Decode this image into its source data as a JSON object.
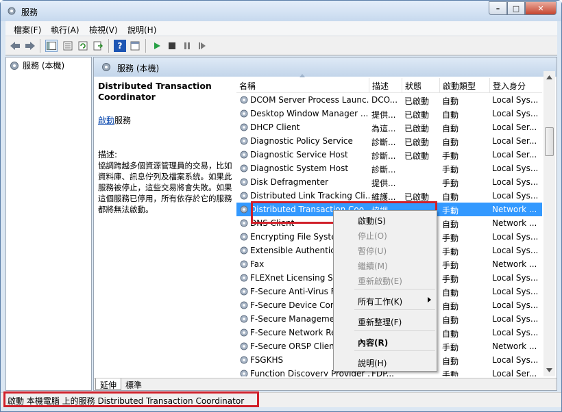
{
  "window": {
    "title": "服務",
    "btn_min": "–",
    "btn_max": "□",
    "btn_close": "✕"
  },
  "menu": [
    "檔案(F)",
    "執行(A)",
    "檢視(V)",
    "說明(H)"
  ],
  "left_tree": {
    "label": "服務 (本機)"
  },
  "right_header": {
    "label": "服務 (本機)"
  },
  "description": {
    "title": "Distributed Transaction Coordinator",
    "start_link": "啟動",
    "start_suffix": "服務",
    "label": "描述:",
    "text": "協調跨越多個資源管理員的交易，比如資料庫、訊息佇列及檔案系統。如果此服務被停止，這些交易將會失敗。如果這個服務已停用，所有依存於它的服務都將無法啟動。"
  },
  "columns": [
    "名稱",
    "描述",
    "狀態",
    "啟動類型",
    "登入身分"
  ],
  "rows": [
    {
      "name": "DCOM Server Process Launc...",
      "desc": "DCO...",
      "status": "已啟動",
      "type": "自動",
      "logon": "Local Sys..."
    },
    {
      "name": "Desktop Window Manager ...",
      "desc": "提供...",
      "status": "已啟動",
      "type": "自動",
      "logon": "Local Sys..."
    },
    {
      "name": "DHCP Client",
      "desc": "為這...",
      "status": "已啟動",
      "type": "自動",
      "logon": "Local Ser..."
    },
    {
      "name": "Diagnostic Policy Service",
      "desc": "診斷...",
      "status": "已啟動",
      "type": "自動",
      "logon": "Local Ser..."
    },
    {
      "name": "Diagnostic Service Host",
      "desc": "診斷...",
      "status": "已啟動",
      "type": "手動",
      "logon": "Local Ser..."
    },
    {
      "name": "Diagnostic System Host",
      "desc": "診斷...",
      "status": "",
      "type": "手動",
      "logon": "Local Sys..."
    },
    {
      "name": "Disk Defragmenter",
      "desc": "提供...",
      "status": "",
      "type": "手動",
      "logon": "Local Sys..."
    },
    {
      "name": "Distributed Link Tracking Cli...",
      "desc": "維護...",
      "status": "已啟動",
      "type": "自動",
      "logon": "Local Sys..."
    },
    {
      "name": "Distributed Transaction Coo...",
      "desc": "協調...",
      "status": "",
      "type": "手動",
      "logon": "Network ..."
    },
    {
      "name": "DNS Client",
      "desc": "",
      "status": "",
      "type": "自動",
      "logon": "Network ..."
    },
    {
      "name": "Encrypting File Syste",
      "desc": "",
      "status": "",
      "type": "手動",
      "logon": "Local Sys..."
    },
    {
      "name": "Extensible Authenticat",
      "desc": "",
      "status": "",
      "type": "手動",
      "logon": "Local Sys..."
    },
    {
      "name": "Fax",
      "desc": "",
      "status": "",
      "type": "手動",
      "logon": "Network ..."
    },
    {
      "name": "FLEXnet Licensing Se",
      "desc": "",
      "status": "",
      "type": "手動",
      "logon": "Local Sys..."
    },
    {
      "name": "F-Secure Anti-Virus F",
      "desc": "",
      "status": "",
      "type": "自動",
      "logon": "Local Sys..."
    },
    {
      "name": "F-Secure Device Con",
      "desc": "",
      "status": "",
      "type": "自動",
      "logon": "Local Sys..."
    },
    {
      "name": "F-Secure Manageme",
      "desc": "",
      "status": "",
      "type": "自動",
      "logon": "Local Sys..."
    },
    {
      "name": "F-Secure Network Re",
      "desc": "",
      "status": "",
      "type": "自動",
      "logon": "Local Sys..."
    },
    {
      "name": "F-Secure ORSP Clien",
      "desc": "",
      "status": "",
      "type": "手動",
      "logon": "Network ..."
    },
    {
      "name": "FSGKHS",
      "desc": "",
      "status": "",
      "type": "自動",
      "logon": "Local Sys..."
    },
    {
      "name": "Function Discovery Provider ...",
      "desc": "FDP...",
      "status": "",
      "type": "手動",
      "logon": "Local Ser..."
    }
  ],
  "context_menu": {
    "start": "啟動(S)",
    "stop": "停止(O)",
    "pause": "暫停(U)",
    "resume": "繼續(M)",
    "restart": "重新啟動(E)",
    "all_tasks": "所有工作(K)",
    "refresh": "重新整理(F)",
    "properties": "內容(R)",
    "help": "說明(H)"
  },
  "tabs": [
    "延伸",
    "標準"
  ],
  "status": "啟動 本機電腦 上的服務 Distributed Transaction Coordinator",
  "colors": {
    "selection": "#3399ff",
    "highlight_box": "#d0202a"
  }
}
